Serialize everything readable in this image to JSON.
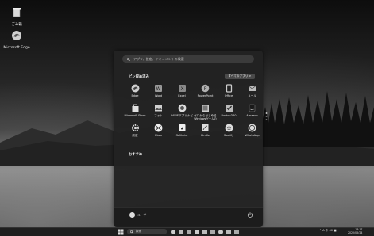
{
  "desktop": {
    "icons": [
      {
        "label": "ごみ箱",
        "icon": "recycle-bin-icon"
      },
      {
        "label": "Microsoft Edge",
        "icon": "edge-icon"
      }
    ]
  },
  "start_menu": {
    "search_placeholder": "アプリ、設定、ドキュメントの検索",
    "pinned_title": "ピン留め済み",
    "all_apps_label": "すべてのアプリ  >",
    "recommended_title": "おすすめ",
    "pinned_apps": [
      {
        "label": "Edge",
        "icon": "edge-icon"
      },
      {
        "label": "Word",
        "icon": "word-icon"
      },
      {
        "label": "Excel",
        "icon": "excel-icon"
      },
      {
        "label": "PowerPoint",
        "icon": "powerpoint-icon"
      },
      {
        "label": "Office",
        "icon": "office-icon"
      },
      {
        "label": "メール",
        "icon": "mail-icon"
      },
      {
        "label": "Microsoft Store",
        "icon": "store-icon"
      },
      {
        "label": "フォト",
        "icon": "photos-icon"
      },
      {
        "label": "LAVIEアプリナビ",
        "icon": "lavie-app-navi-icon"
      },
      {
        "label": "ゼロからはじめる",
        "label2": "Windowsゲームの",
        "icon": "book-icon"
      },
      {
        "label": "Norton360",
        "icon": "norton-icon"
      },
      {
        "label": "Amazon",
        "icon": "amazon-icon"
      },
      {
        "label": "設定",
        "icon": "settings-icon"
      },
      {
        "label": "Xbox",
        "icon": "xbox-icon"
      },
      {
        "label": "Solitaire",
        "icon": "solitaire-icon"
      },
      {
        "label": "Kindle",
        "icon": "kindle-icon"
      },
      {
        "label": "Spotify",
        "icon": "spotify-icon"
      },
      {
        "label": "WhatsApp",
        "icon": "whatsapp-icon"
      }
    ],
    "username": "ユーザー"
  },
  "taskbar": {
    "search_label": "検索",
    "tray_text": "^  A  令  40 ■",
    "time": "18:17",
    "date": "2022/05/24"
  }
}
